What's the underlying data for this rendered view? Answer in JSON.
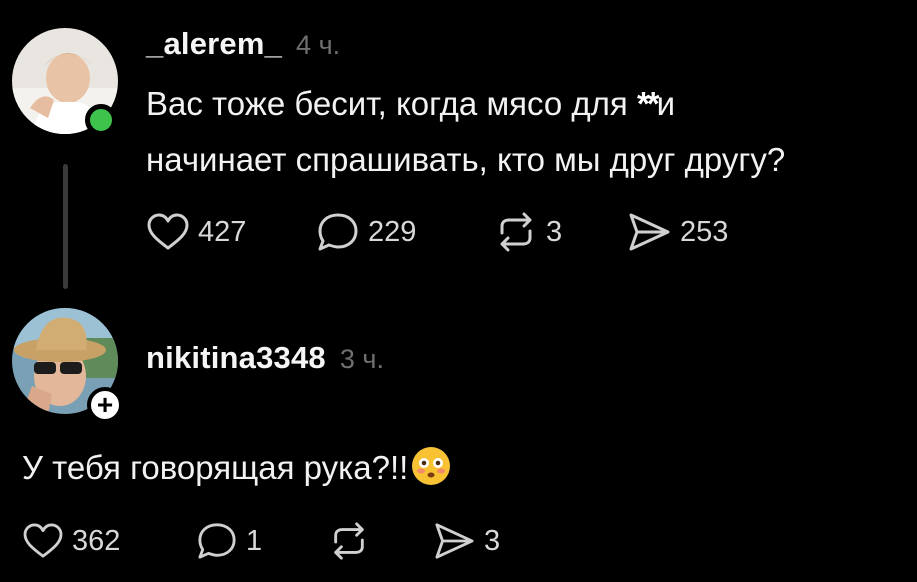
{
  "comments": [
    {
      "username": "_alerem_",
      "time": "4 ч.",
      "text_line1": "Вас тоже бесит, когда мясо для ",
      "censored": "**",
      "text_line1_end": "и",
      "text_line2": "начинает спрашивать, кто мы друг другу?",
      "likes": "427",
      "replies": "229",
      "reposts": "3",
      "shares": "253",
      "online_color": "#3ec34d"
    },
    {
      "username": "nikitina3348",
      "time": "3 ч.",
      "text": "У тебя говорящая рука?!!",
      "emoji": "flushed-face-emoji",
      "likes": "362",
      "replies": "1",
      "shares": "3"
    }
  ]
}
